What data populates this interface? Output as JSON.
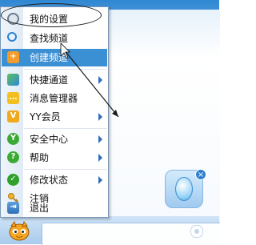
{
  "menu": {
    "items": [
      {
        "label": "我的设置",
        "icon": "gear-icon",
        "has_submenu": false,
        "highlighted": false
      },
      {
        "label": "查找频道",
        "icon": "search-icon",
        "has_submenu": false,
        "highlighted": false
      },
      {
        "label": "创建频道",
        "icon": "create-channel-icon",
        "has_submenu": false,
        "highlighted": true
      },
      {
        "label": "快捷通道",
        "icon": "shortcut-icon",
        "has_submenu": true,
        "highlighted": false
      },
      {
        "label": "消息管理器",
        "icon": "message-icon",
        "has_submenu": false,
        "highlighted": false
      },
      {
        "label": "YY会员",
        "icon": "vip-icon",
        "has_submenu": true,
        "highlighted": false
      },
      {
        "label": "安全中心",
        "icon": "shield-icon",
        "has_submenu": true,
        "highlighted": false
      },
      {
        "label": "帮助",
        "icon": "help-icon",
        "has_submenu": true,
        "highlighted": false
      },
      {
        "label": "修改状态",
        "icon": "status-icon",
        "has_submenu": true,
        "highlighted": false
      },
      {
        "label": "注销",
        "icon": "key-icon",
        "has_submenu": false,
        "highlighted": false
      },
      {
        "label": "退出",
        "icon": "exit-icon",
        "has_submenu": false,
        "highlighted": false
      }
    ]
  },
  "colors": {
    "highlight": "#3b8fd3",
    "submenu_arrow": "#2f6fb8",
    "title_gradient_top": "#2f87d2"
  }
}
